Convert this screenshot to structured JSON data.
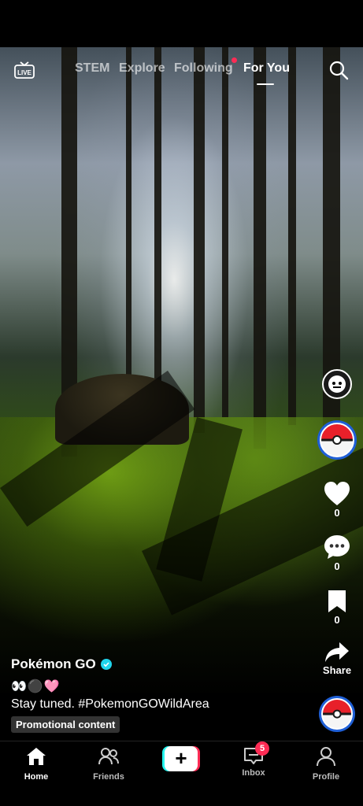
{
  "top_nav": {
    "live_label": "LIVE",
    "tabs": [
      {
        "label": "STEM"
      },
      {
        "label": "Explore"
      },
      {
        "label": "Following"
      },
      {
        "label": "For You"
      }
    ],
    "active_tab": "For You"
  },
  "right_rail": {
    "like_count": "0",
    "comment_count": "0",
    "bookmark_count": "0",
    "share_label": "Share"
  },
  "post": {
    "username": "Pokémon GO",
    "emojis": "👀⚫🩷",
    "description": "Stay tuned. #PokemonGOWildArea",
    "promo_label": "Promotional content"
  },
  "bottom_nav": {
    "items": [
      {
        "label": "Home",
        "icon": "home-icon"
      },
      {
        "label": "Friends",
        "icon": "friends-icon"
      },
      {
        "label": "Inbox",
        "icon": "inbox-icon",
        "badge": "5"
      },
      {
        "label": "Profile",
        "icon": "profile-icon"
      }
    ]
  },
  "colors": {
    "accent_red": "#fe2c55",
    "accent_cyan": "#25f4ee",
    "verified": "#20d5ec"
  }
}
